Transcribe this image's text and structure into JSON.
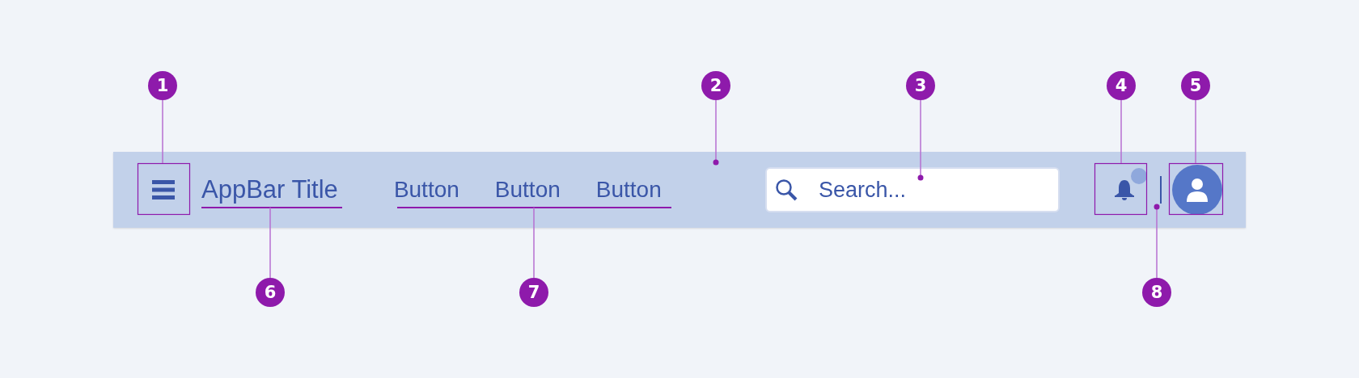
{
  "app_bar": {
    "title": "AppBar Title",
    "buttons": [
      "Button",
      "Button",
      "Button"
    ],
    "search": {
      "placeholder": "Search..."
    }
  },
  "callouts": [
    {
      "number": "1"
    },
    {
      "number": "2"
    },
    {
      "number": "3"
    },
    {
      "number": "4"
    },
    {
      "number": "5"
    },
    {
      "number": "6"
    },
    {
      "number": "7"
    },
    {
      "number": "8"
    }
  ]
}
